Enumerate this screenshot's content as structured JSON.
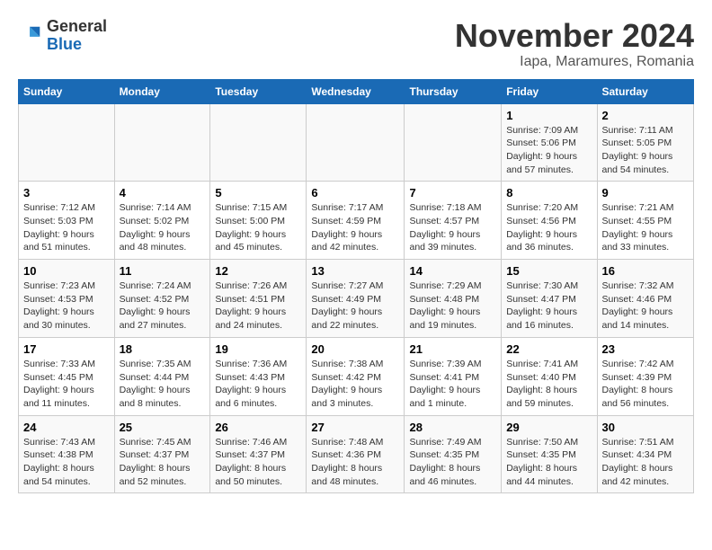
{
  "logo": {
    "general": "General",
    "blue": "Blue"
  },
  "header": {
    "month": "November 2024",
    "location": "Iapa, Maramures, Romania"
  },
  "weekdays": [
    "Sunday",
    "Monday",
    "Tuesday",
    "Wednesday",
    "Thursday",
    "Friday",
    "Saturday"
  ],
  "weeks": [
    [
      {
        "day": "",
        "info": ""
      },
      {
        "day": "",
        "info": ""
      },
      {
        "day": "",
        "info": ""
      },
      {
        "day": "",
        "info": ""
      },
      {
        "day": "",
        "info": ""
      },
      {
        "day": "1",
        "info": "Sunrise: 7:09 AM\nSunset: 5:06 PM\nDaylight: 9 hours and 57 minutes."
      },
      {
        "day": "2",
        "info": "Sunrise: 7:11 AM\nSunset: 5:05 PM\nDaylight: 9 hours and 54 minutes."
      }
    ],
    [
      {
        "day": "3",
        "info": "Sunrise: 7:12 AM\nSunset: 5:03 PM\nDaylight: 9 hours and 51 minutes."
      },
      {
        "day": "4",
        "info": "Sunrise: 7:14 AM\nSunset: 5:02 PM\nDaylight: 9 hours and 48 minutes."
      },
      {
        "day": "5",
        "info": "Sunrise: 7:15 AM\nSunset: 5:00 PM\nDaylight: 9 hours and 45 minutes."
      },
      {
        "day": "6",
        "info": "Sunrise: 7:17 AM\nSunset: 4:59 PM\nDaylight: 9 hours and 42 minutes."
      },
      {
        "day": "7",
        "info": "Sunrise: 7:18 AM\nSunset: 4:57 PM\nDaylight: 9 hours and 39 minutes."
      },
      {
        "day": "8",
        "info": "Sunrise: 7:20 AM\nSunset: 4:56 PM\nDaylight: 9 hours and 36 minutes."
      },
      {
        "day": "9",
        "info": "Sunrise: 7:21 AM\nSunset: 4:55 PM\nDaylight: 9 hours and 33 minutes."
      }
    ],
    [
      {
        "day": "10",
        "info": "Sunrise: 7:23 AM\nSunset: 4:53 PM\nDaylight: 9 hours and 30 minutes."
      },
      {
        "day": "11",
        "info": "Sunrise: 7:24 AM\nSunset: 4:52 PM\nDaylight: 9 hours and 27 minutes."
      },
      {
        "day": "12",
        "info": "Sunrise: 7:26 AM\nSunset: 4:51 PM\nDaylight: 9 hours and 24 minutes."
      },
      {
        "day": "13",
        "info": "Sunrise: 7:27 AM\nSunset: 4:49 PM\nDaylight: 9 hours and 22 minutes."
      },
      {
        "day": "14",
        "info": "Sunrise: 7:29 AM\nSunset: 4:48 PM\nDaylight: 9 hours and 19 minutes."
      },
      {
        "day": "15",
        "info": "Sunrise: 7:30 AM\nSunset: 4:47 PM\nDaylight: 9 hours and 16 minutes."
      },
      {
        "day": "16",
        "info": "Sunrise: 7:32 AM\nSunset: 4:46 PM\nDaylight: 9 hours and 14 minutes."
      }
    ],
    [
      {
        "day": "17",
        "info": "Sunrise: 7:33 AM\nSunset: 4:45 PM\nDaylight: 9 hours and 11 minutes."
      },
      {
        "day": "18",
        "info": "Sunrise: 7:35 AM\nSunset: 4:44 PM\nDaylight: 9 hours and 8 minutes."
      },
      {
        "day": "19",
        "info": "Sunrise: 7:36 AM\nSunset: 4:43 PM\nDaylight: 9 hours and 6 minutes."
      },
      {
        "day": "20",
        "info": "Sunrise: 7:38 AM\nSunset: 4:42 PM\nDaylight: 9 hours and 3 minutes."
      },
      {
        "day": "21",
        "info": "Sunrise: 7:39 AM\nSunset: 4:41 PM\nDaylight: 9 hours and 1 minute."
      },
      {
        "day": "22",
        "info": "Sunrise: 7:41 AM\nSunset: 4:40 PM\nDaylight: 8 hours and 59 minutes."
      },
      {
        "day": "23",
        "info": "Sunrise: 7:42 AM\nSunset: 4:39 PM\nDaylight: 8 hours and 56 minutes."
      }
    ],
    [
      {
        "day": "24",
        "info": "Sunrise: 7:43 AM\nSunset: 4:38 PM\nDaylight: 8 hours and 54 minutes."
      },
      {
        "day": "25",
        "info": "Sunrise: 7:45 AM\nSunset: 4:37 PM\nDaylight: 8 hours and 52 minutes."
      },
      {
        "day": "26",
        "info": "Sunrise: 7:46 AM\nSunset: 4:37 PM\nDaylight: 8 hours and 50 minutes."
      },
      {
        "day": "27",
        "info": "Sunrise: 7:48 AM\nSunset: 4:36 PM\nDaylight: 8 hours and 48 minutes."
      },
      {
        "day": "28",
        "info": "Sunrise: 7:49 AM\nSunset: 4:35 PM\nDaylight: 8 hours and 46 minutes."
      },
      {
        "day": "29",
        "info": "Sunrise: 7:50 AM\nSunset: 4:35 PM\nDaylight: 8 hours and 44 minutes."
      },
      {
        "day": "30",
        "info": "Sunrise: 7:51 AM\nSunset: 4:34 PM\nDaylight: 8 hours and 42 minutes."
      }
    ]
  ]
}
